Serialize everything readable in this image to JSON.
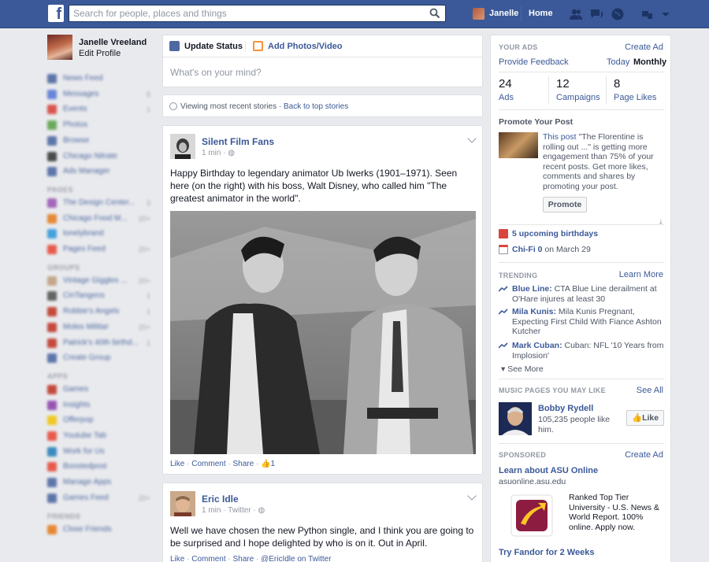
{
  "topbar": {
    "logo": "f",
    "search_placeholder": "Search for people, places and things",
    "user_name": "Janelle",
    "home_label": "Home"
  },
  "left_nav": {
    "profile_name": "Janelle Vreeland",
    "edit_profile": "Edit Profile",
    "favorites": [
      {
        "label": "News Feed",
        "count": "",
        "color": "#4e69a2"
      },
      {
        "label": "Messages",
        "count": "5",
        "color": "#5b7bd5"
      },
      {
        "label": "Events",
        "count": "1",
        "color": "#d8453e"
      },
      {
        "label": "Photos",
        "count": "",
        "color": "#60a34c"
      },
      {
        "label": "Browse",
        "count": "",
        "color": "#4e69a2"
      },
      {
        "label": "Chicago Nitrate",
        "count": "",
        "color": "#3a3a3a"
      },
      {
        "label": "Ads Manager",
        "count": "",
        "color": "#4e69a2"
      }
    ],
    "pages_header": "PAGES",
    "pages": [
      {
        "label": "The Design Center...",
        "count": "3",
        "color": "#9b59b6"
      },
      {
        "label": "Chicago Food M...",
        "count": "20+",
        "color": "#e67e22"
      },
      {
        "label": "lonelybrand",
        "count": "",
        "color": "#3498db"
      },
      {
        "label": "Pages Feed",
        "count": "20+",
        "color": "#e74c3c"
      }
    ],
    "groups_header": "GROUPS",
    "groups": [
      {
        "label": "Vintage Giggles ...",
        "count": "20+",
        "color": "#c0a080"
      },
      {
        "label": "CinTangens",
        "count": "1",
        "color": "#555555"
      },
      {
        "label": "Robbie's Angels",
        "count": "1",
        "color": "#c0392b"
      },
      {
        "label": "Moles Militia!",
        "count": "20+",
        "color": "#c0392b"
      },
      {
        "label": "Patrick's 40th birthd...",
        "count": "1",
        "color": "#c0392b"
      },
      {
        "label": "Create Group",
        "count": "",
        "color": "#4e69a2"
      }
    ],
    "apps_header": "APPS",
    "apps": [
      {
        "label": "Games",
        "count": "",
        "color": "#c0392b"
      },
      {
        "label": "Insights",
        "count": "",
        "color": "#8e44ad"
      },
      {
        "label": "Offerpop",
        "count": "",
        "color": "#f1c40f"
      },
      {
        "label": "Youtube Tab",
        "count": "",
        "color": "#e74c3c"
      },
      {
        "label": "Work for Us",
        "count": "",
        "color": "#2980b9"
      },
      {
        "label": "Boostedpost",
        "count": "",
        "color": "#e74c3c"
      },
      {
        "label": "Manage Apps",
        "count": "",
        "color": "#4e69a2"
      },
      {
        "label": "Games Feed",
        "count": "20+",
        "color": "#4e69a2"
      }
    ],
    "friends_header": "FRIENDS",
    "friends": [
      {
        "label": "Close Friends",
        "count": "",
        "color": "#e67e22"
      }
    ]
  },
  "composer": {
    "tab_update": "Update Status",
    "tab_photos": "Add Photos/Video",
    "placeholder": "What's on your mind?"
  },
  "viewing_bar": {
    "text": "Viewing most recent stories · ",
    "back_link": "Back to top stories"
  },
  "post1": {
    "author": "Silent Film Fans",
    "meta": "1 min · ",
    "text": "Happy Birthday to legendary animator Ub Iwerks (1901–1971). Seen here (on the right) with his boss, Walt Disney, who called him \"The greatest animator in the world\".",
    "like": "Like",
    "comment": "Comment",
    "share": "Share",
    "like_count": "1"
  },
  "post2": {
    "author": "Eric Idle",
    "meta": "1 min · Twitter · ",
    "text": "Well we have chosen the new Python single, and I think you are going to be surprised and I hope delighted by who is on it. Out in April.",
    "like": "Like",
    "comment": "Comment",
    "share": "Share",
    "twitter_link": "@EricIdle on Twitter"
  },
  "right": {
    "your_ads": "YOUR ADS",
    "create_ad": "Create Ad",
    "provide_feedback": "Provide Feedback",
    "today": "Today",
    "monthly": "Monthly",
    "stats": [
      {
        "num": "24",
        "label": "Ads"
      },
      {
        "num": "12",
        "label": "Campaigns"
      },
      {
        "num": "8",
        "label": "Page Likes"
      }
    ],
    "promote_header": "Promote Your Post",
    "promote_text_link": "This post",
    "promote_text": " \"The Florentine is rolling out ...\" is getting more engagement than 75% of your recent posts. Get more likes, comments and shares by promoting your post.",
    "promote_button": "Promote",
    "birthdays": "5 upcoming birthdays",
    "event_name": "Chi-Fi 0",
    "event_date": " on March 29",
    "trending_header": "TRENDING",
    "learn_more": "Learn More",
    "trends": [
      {
        "name": "Blue Line:",
        "text": " CTA Blue Line derailment at O'Hare injures at least 30"
      },
      {
        "name": "Mila Kunis:",
        "text": " Mila Kunis Pregnant, Expecting First Child With Fiance Ashton Kutcher"
      },
      {
        "name": "Mark Cuban:",
        "text": " Cuban: NFL '10 Years from Implosion'"
      }
    ],
    "see_more": "See More",
    "music_header": "MUSIC PAGES YOU MAY LIKE",
    "see_all": "See All",
    "music_name": "Bobby Rydell",
    "music_likes": "105,235 people like him.",
    "like_button": "Like",
    "sponsored_header": "SPONSORED",
    "sponsored_create_ad": "Create Ad",
    "ad1_title": "Learn about ASU Online",
    "ad1_url": "asuonline.asu.edu",
    "ad1_text": "Ranked Top Tier University - U.S. News & World Report. 100% online. Apply now.",
    "ad2_title": "Try Fandor for 2 Weeks"
  }
}
